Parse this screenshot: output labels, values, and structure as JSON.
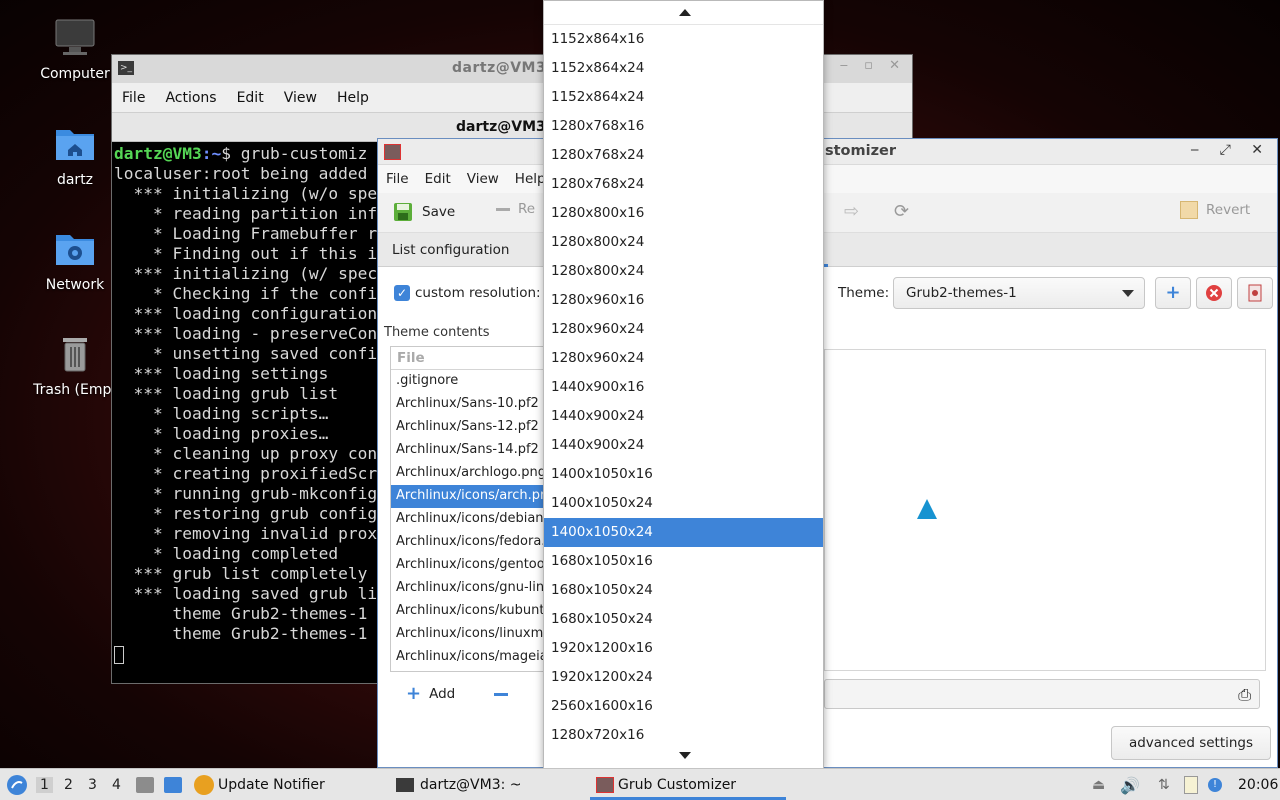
{
  "desktop": {
    "icons": [
      {
        "label": "Computer",
        "icon": "computer-icon"
      },
      {
        "label": "dartz",
        "icon": "home-folder-icon"
      },
      {
        "label": "Network",
        "icon": "network-folder-icon"
      },
      {
        "label": "Trash (Empt",
        "icon": "trash-icon"
      }
    ]
  },
  "terminal": {
    "title": "dartz@VM3",
    "menu": [
      "File",
      "Actions",
      "Edit",
      "View",
      "Help"
    ],
    "tab_title": "dartz@VM3: ~",
    "prompt_user": "dartz@VM3",
    "prompt_path": ":~",
    "prompt_cmd": "$ grub-customiz",
    "lines": [
      "localuser:root being added",
      "  *** initializing (w/o spe",
      "    * reading partition info",
      "    * Loading Framebuffer re",
      "    * Finding out if this i",
      "  *** initializing (w/ spec",
      "    * Checking if the confi",
      "  *** loading configuration",
      "  *** loading - preserveCon",
      "    * unsetting saved confi",
      "  *** loading settings",
      "  *** loading grub list",
      "    * loading scripts…",
      "    * loading proxies…",
      "    * cleaning up proxy con",
      "    * creating proxifiedScr",
      "    * running grub-mkconfig",
      "    * restoring grub config",
      "    * removing invalid prox",
      "    * loading completed",
      "  *** grub list completely",
      "  *** loading saved grub li",
      "      theme Grub2-themes-1",
      "      theme Grub2-themes-1"
    ]
  },
  "grub": {
    "title": "stomizer",
    "menu": [
      "File",
      "Edit",
      "View",
      "Help"
    ],
    "toolbar": {
      "save": "Save",
      "remove": "Re",
      "revert": "Revert"
    },
    "tab": "List configuration",
    "custom_resolution_label": "custom resolution:",
    "theme_label": "Theme:",
    "theme_value": "Grub2-themes-1",
    "theme_contents_label": "Theme contents",
    "file_header": "File",
    "files": [
      ".gitignore",
      "Archlinux/Sans-10.pf2",
      "Archlinux/Sans-12.pf2",
      "Archlinux/Sans-14.pf2",
      "Archlinux/archlogo.png",
      "Archlinux/icons/arch.pn",
      "Archlinux/icons/debian",
      "Archlinux/icons/fedora.",
      "Archlinux/icons/gentoo",
      "Archlinux/icons/gnu-lin",
      "Archlinux/icons/kubunt",
      "Archlinux/icons/linuxm",
      "Archlinux/icons/mageia"
    ],
    "selected_file_index": 5,
    "add_label": "Add",
    "advanced_settings": "advanced settings"
  },
  "resolution_dropdown": {
    "options": [
      "1152x864x16",
      "1152x864x24",
      "1152x864x24",
      "1280x768x16",
      "1280x768x24",
      "1280x768x24",
      "1280x800x16",
      "1280x800x24",
      "1280x800x24",
      "1280x960x16",
      "1280x960x24",
      "1280x960x24",
      "1440x900x16",
      "1440x900x24",
      "1440x900x24",
      "1400x1050x16",
      "1400x1050x24",
      "1400x1050x24",
      "1680x1050x16",
      "1680x1050x24",
      "1680x1050x24",
      "1920x1200x16",
      "1920x1200x24",
      "2560x1600x16",
      "1280x720x16"
    ],
    "selected_index": 17
  },
  "taskbar": {
    "workspaces": [
      "1",
      "2",
      "3",
      "4"
    ],
    "tasks": [
      "Update Notifier",
      "dartz@VM3: ~",
      "Grub Customizer"
    ],
    "clock": "20:06",
    "accent": "#3e84d8"
  }
}
